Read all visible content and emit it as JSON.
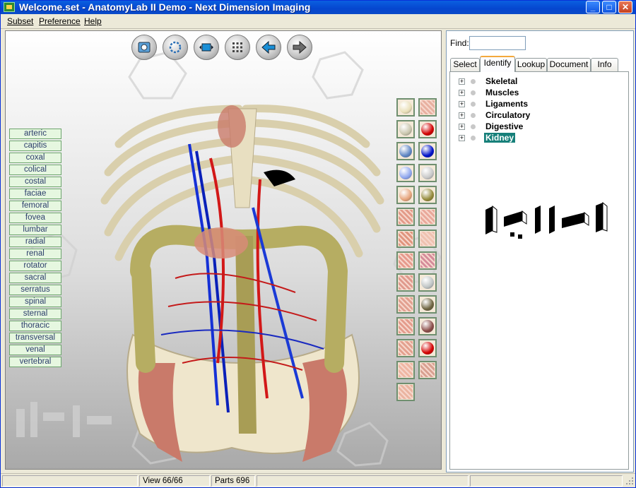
{
  "window": {
    "title": "Welcome.set - AnatomyLab II Demo - Next Dimension Imaging",
    "min_glyph": "_",
    "max_glyph": "□",
    "close_glyph": "✕"
  },
  "menu": [
    {
      "label": "Subset"
    },
    {
      "label": "Preference"
    },
    {
      "label": "Help"
    }
  ],
  "toolbar": [
    {
      "icon": "camera-icon"
    },
    {
      "icon": "rotate-icon"
    },
    {
      "icon": "fit-view-icon"
    },
    {
      "icon": "grid-icon"
    },
    {
      "icon": "back-arrow-icon"
    },
    {
      "icon": "forward-arrow-icon"
    }
  ],
  "terms": [
    "arteric",
    "capitis",
    "coxal",
    "colical",
    "costal",
    "faciae",
    "femoral",
    "fovea",
    "lumbar",
    "radial",
    "renal",
    "rotator",
    "sacral",
    "serratus",
    "spinal",
    "sternal",
    "thoracic",
    "transversal",
    "venal",
    "vertebral"
  ],
  "swatches": [
    {
      "kind": "ball",
      "color": "#e9dfb8"
    },
    {
      "kind": "tex",
      "color": "#e8b0a0"
    },
    {
      "kind": "ball",
      "color": "#c9c6ad"
    },
    {
      "kind": "ball",
      "color": "#d20000"
    },
    {
      "kind": "ball",
      "color": "#5f86c4"
    },
    {
      "kind": "ball",
      "color": "#0012c8"
    },
    {
      "kind": "ball",
      "color": "#8fa6ee"
    },
    {
      "kind": "ball",
      "color": "#c8c8c8"
    },
    {
      "kind": "ball",
      "color": "#e6a47c"
    },
    {
      "kind": "ball",
      "color": "#948a3a"
    },
    {
      "kind": "tex",
      "color": "#e39a88"
    },
    {
      "kind": "tex",
      "color": "#e9a89a"
    },
    {
      "kind": "tex",
      "color": "#e0957d"
    },
    {
      "kind": "tex",
      "color": "#efc2b0"
    },
    {
      "kind": "tex",
      "color": "#e69a8c"
    },
    {
      "kind": "tex",
      "color": "#d58c9a"
    },
    {
      "kind": "tex",
      "color": "#e0998c"
    },
    {
      "kind": "ball",
      "color": "#bfc4c4"
    },
    {
      "kind": "tex",
      "color": "#e2a090"
    },
    {
      "kind": "ball",
      "color": "#6e6440"
    },
    {
      "kind": "tex",
      "color": "#e49c8c"
    },
    {
      "kind": "ball",
      "color": "#8a4c48"
    },
    {
      "kind": "tex",
      "color": "#e3a08e"
    },
    {
      "kind": "ball",
      "color": "#d40000"
    },
    {
      "kind": "tex",
      "color": "#efb6a2"
    },
    {
      "kind": "tex",
      "color": "#d8a090"
    },
    {
      "kind": "tex",
      "color": "#eab4a0"
    }
  ],
  "find": {
    "label": "Find:",
    "value": ""
  },
  "tabs": [
    {
      "label": "Select"
    },
    {
      "label": "Identify"
    },
    {
      "label": "Lookup"
    },
    {
      "label": "Document"
    },
    {
      "label": "Info"
    }
  ],
  "tree": [
    {
      "label": "Skeletal"
    },
    {
      "label": "Muscles"
    },
    {
      "label": "Ligaments"
    },
    {
      "label": "Circulatory"
    },
    {
      "label": "Digestive"
    },
    {
      "label": "Kidney"
    }
  ],
  "tree_plus_glyph": "+",
  "status": {
    "view": "View 66/66",
    "parts": "Parts 696"
  }
}
